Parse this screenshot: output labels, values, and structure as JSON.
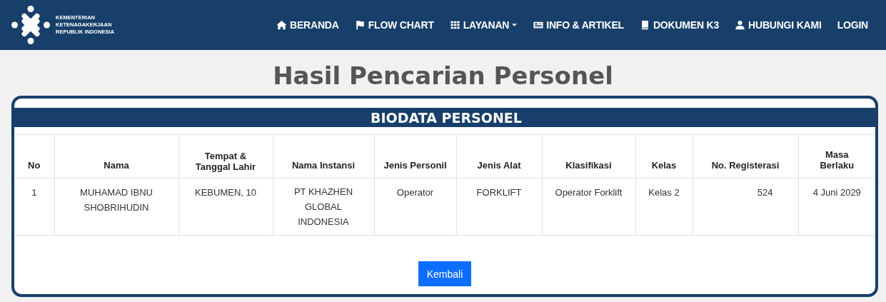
{
  "brand": {
    "lines": [
      "KEMENTERIAN",
      "KETENAGAKERJAAN",
      "REPUBLIK INDONESIA"
    ]
  },
  "nav": [
    {
      "label": "BERANDA",
      "dropdown": false
    },
    {
      "label": "FLOW CHART",
      "dropdown": false
    },
    {
      "label": "LAYANAN",
      "dropdown": true
    },
    {
      "label": "INFO & ARTIKEL",
      "dropdown": false
    },
    {
      "label": "DOKUMEN K3",
      "dropdown": false
    },
    {
      "label": "HUBUNGI KAMI",
      "dropdown": false
    },
    {
      "label": "LOGIN",
      "dropdown": false
    }
  ],
  "page_title": "Hasil Pencarian Personel",
  "card": {
    "title": "BIODATA PERSONEL",
    "table": {
      "columns": [
        "No",
        "Nama",
        "Tempat & Tanggal Lahir",
        "Nama Instansi",
        "Jenis Personil",
        "Jenis Alat",
        "Klasifikasi",
        "Kelas",
        "No. Registerasi",
        "Masa Berlaku"
      ],
      "rows": [
        [
          "1",
          "MUHAMAD IBNU SHOBRIHUDIN",
          "KEBUMEN, 10",
          "PT KHAZHEN GLOBAL INDONESIA",
          "Operator",
          "FORKLIFT",
          "Operator Forklift",
          "Kelas 2",
          "524",
          "4 Juni 2029"
        ]
      ]
    },
    "button": "Kembali"
  }
}
